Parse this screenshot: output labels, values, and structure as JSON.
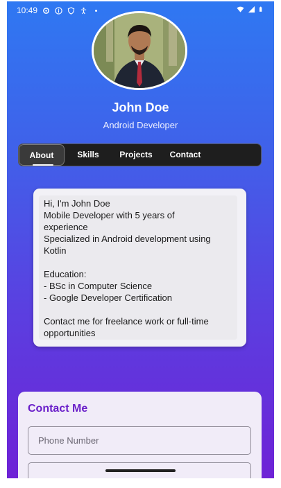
{
  "status_bar": {
    "time": "10:49",
    "left_icons": [
      "settings-icon",
      "info-icon",
      "shield-icon",
      "accessibility-icon",
      "dot-icon"
    ],
    "right_icons": [
      "wifi-icon",
      "signal-icon",
      "battery-icon"
    ]
  },
  "profile": {
    "name": "John Doe",
    "role": "Android Developer"
  },
  "tabs": [
    {
      "label": "About",
      "active": true
    },
    {
      "label": "Skills",
      "active": false
    },
    {
      "label": "Projects",
      "active": false
    },
    {
      "label": "Contact",
      "active": false
    }
  ],
  "about": {
    "lines": [
      "Hi, I'm John Doe",
      "Mobile Developer with 5 years of",
      "experience",
      "Specialized in Android development using",
      "Kotlin",
      "",
      "Education:",
      "- BSc in Computer Science",
      "- Google Developer Certification",
      "",
      "Contact me for freelance work or full-time",
      "opportunities"
    ]
  },
  "contact": {
    "title": "Contact Me",
    "phone_placeholder": "Phone Number",
    "second_field_placeholder": ""
  },
  "colors": {
    "gradient_top": "#2f78f2",
    "gradient_bottom": "#6e22d6",
    "accent": "#6a1fc9",
    "tab_bar": "#1e1e1e"
  }
}
